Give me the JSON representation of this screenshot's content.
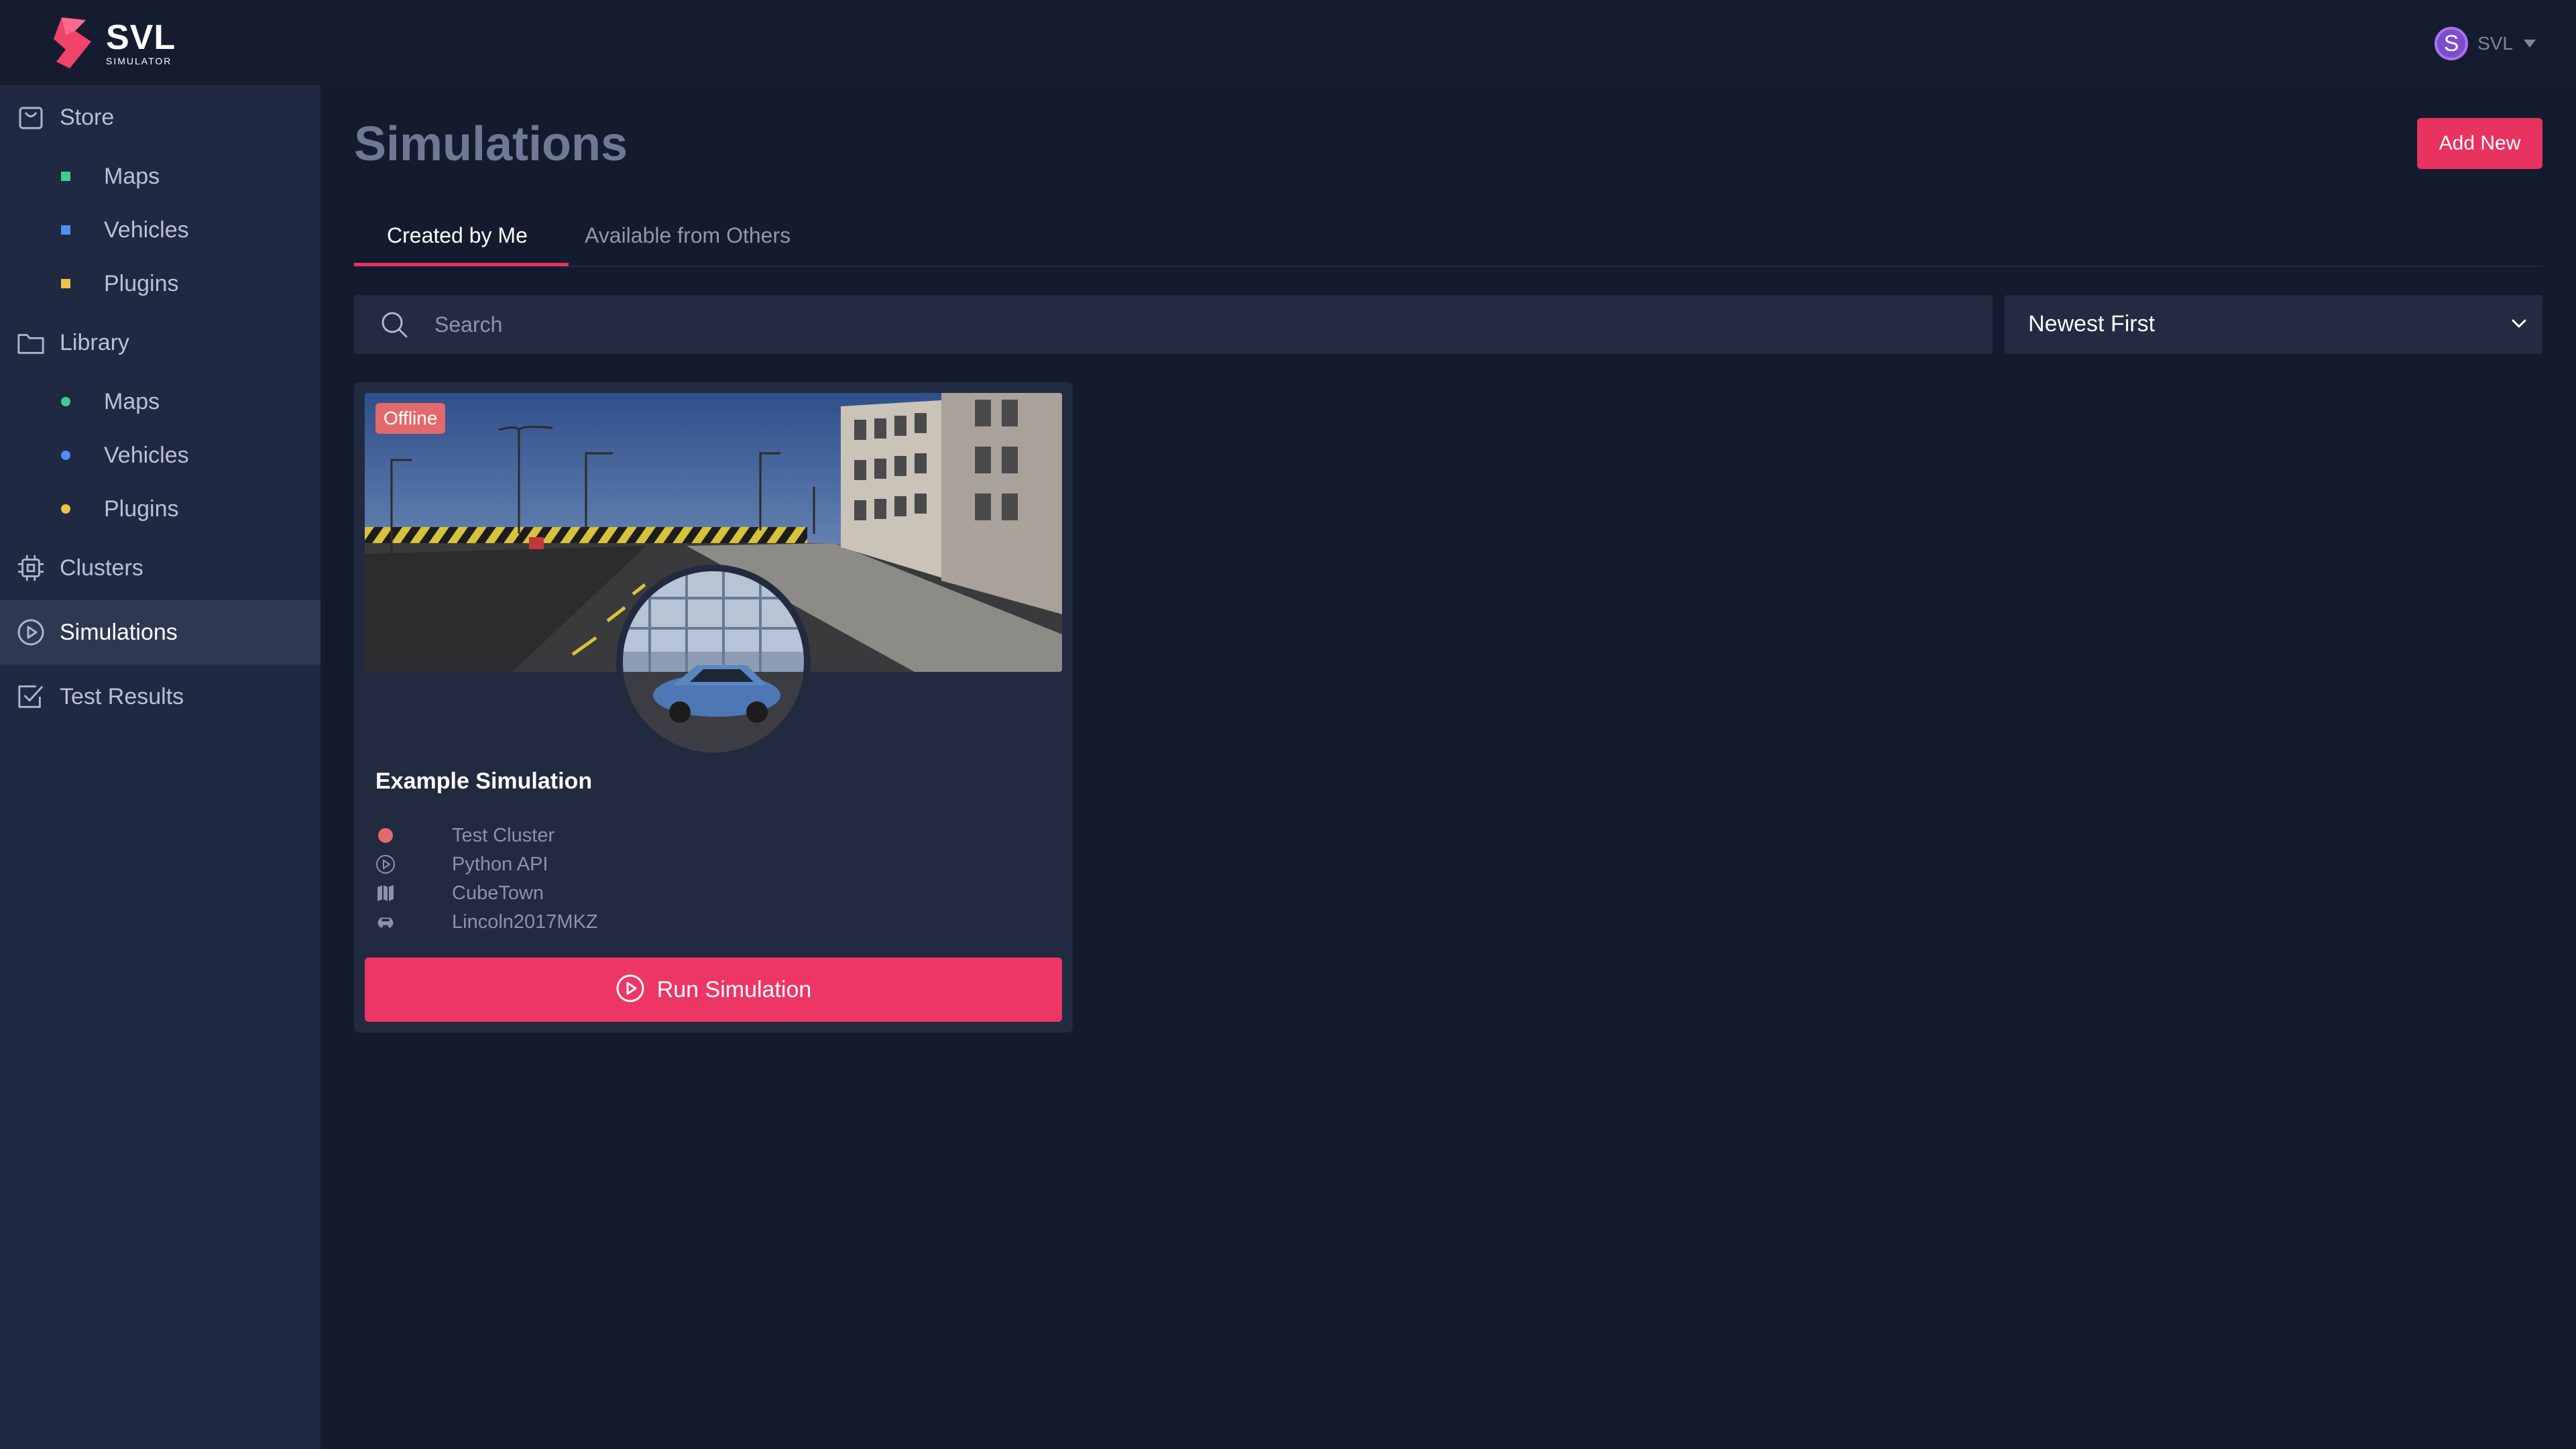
{
  "brand": {
    "name": "SVL",
    "tagline": "SIMULATOR"
  },
  "user": {
    "initial": "S",
    "name": "SVL"
  },
  "sidebar": {
    "sections": [
      {
        "label": "Store",
        "icon": "bag-icon",
        "items": [
          {
            "label": "Maps",
            "color": "#3ecf8e"
          },
          {
            "label": "Vehicles",
            "color": "#4f8ef7"
          },
          {
            "label": "Plugins",
            "color": "#f0c246"
          }
        ]
      },
      {
        "label": "Library",
        "icon": "folder-icon",
        "items": [
          {
            "label": "Maps",
            "color": "#3ecf8e"
          },
          {
            "label": "Vehicles",
            "color": "#4f8ef7"
          },
          {
            "label": "Plugins",
            "color": "#f0c246"
          }
        ]
      }
    ],
    "links": [
      {
        "label": "Clusters",
        "icon": "cpu-icon"
      },
      {
        "label": "Simulations",
        "icon": "play-circle-icon",
        "active": true
      },
      {
        "label": "Test Results",
        "icon": "checkbox-icon"
      }
    ]
  },
  "page": {
    "title": "Simulations",
    "add_label": "Add New"
  },
  "tabs": [
    {
      "label": "Created by Me",
      "active": true
    },
    {
      "label": "Available from Others",
      "active": false
    }
  ],
  "search": {
    "placeholder": "Search"
  },
  "sort": {
    "selected": "Newest First"
  },
  "simulation": {
    "status": "Offline",
    "title": "Example Simulation",
    "cluster": "Test Cluster",
    "api": "Python API",
    "map": "CubeTown",
    "vehicle": "Lincoln2017MKZ",
    "run_label": "Run Simulation"
  },
  "colors": {
    "accent": "#e8325f",
    "status_offline": "#e36a6a",
    "cluster_dot": "#e36a6a"
  }
}
